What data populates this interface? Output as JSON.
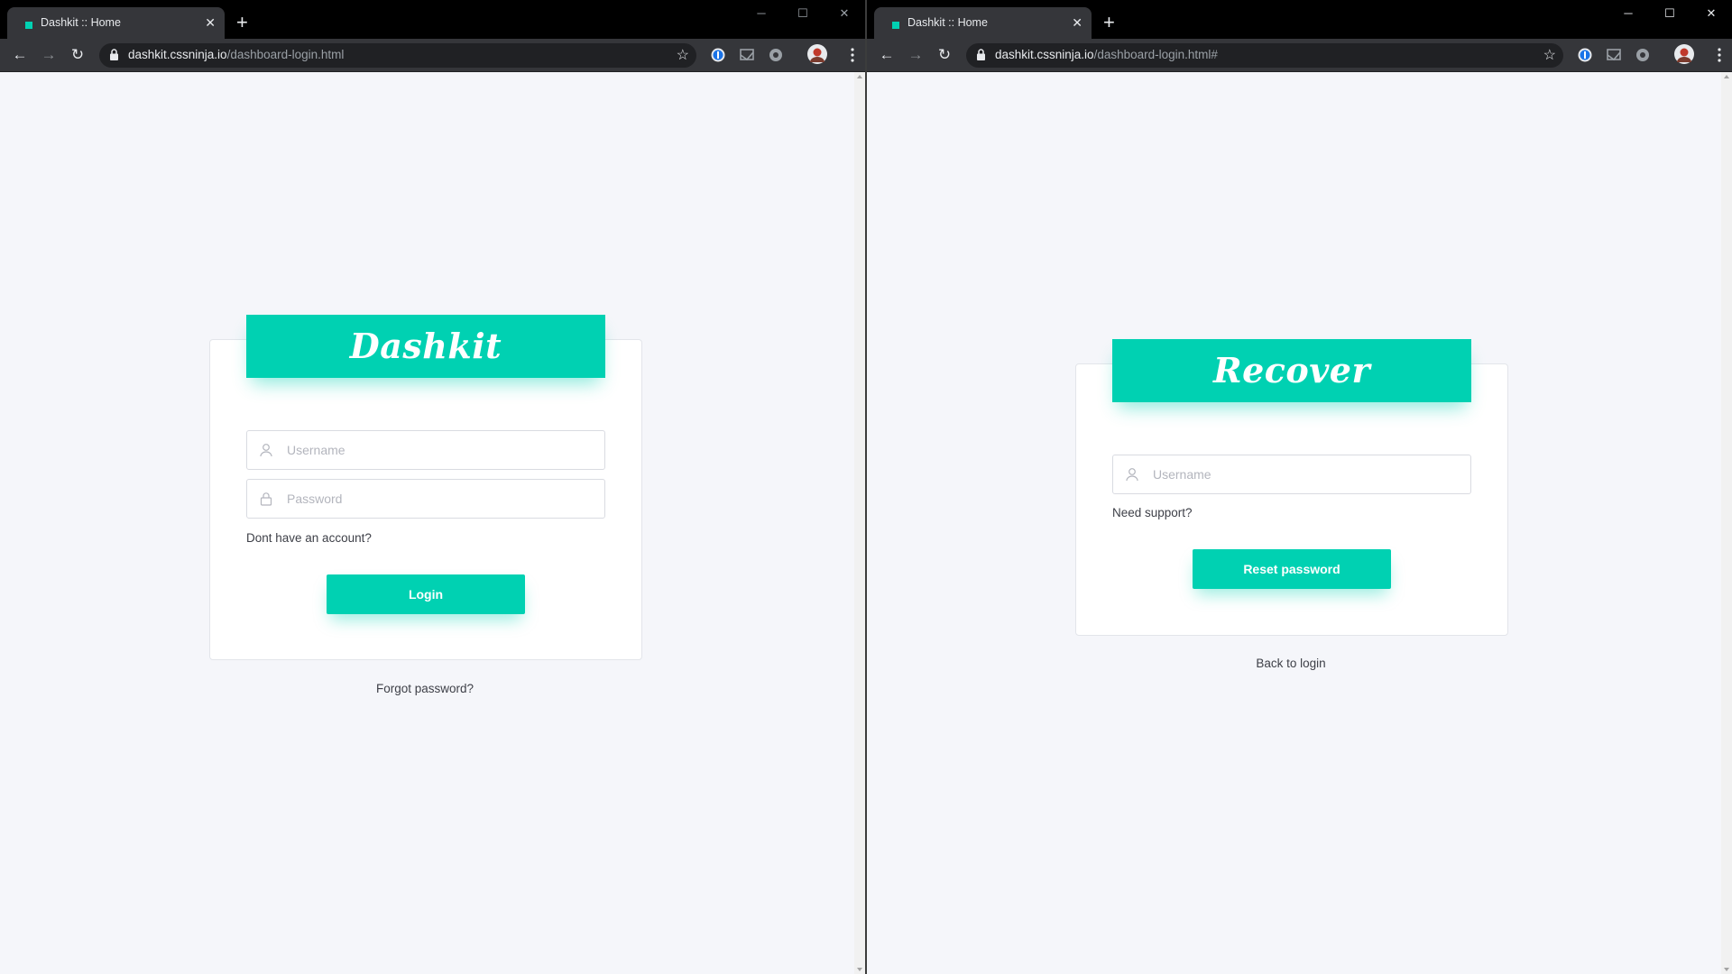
{
  "left_window": {
    "tab_title": "Dashkit :: Home",
    "url_host": "dashkit.cssninja.io",
    "url_path": "/dashboard-login.html",
    "page": {
      "brand": "Dashkit",
      "username_placeholder": "Username",
      "password_placeholder": "Password",
      "signup_link": "Dont have an account?",
      "login_button": "Login",
      "forgot_link": "Forgot password?"
    }
  },
  "right_window": {
    "tab_title": "Dashkit :: Home",
    "url_host": "dashkit.cssninja.io",
    "url_path": "/dashboard-login.html#",
    "page": {
      "heading": "Recover",
      "username_placeholder": "Username",
      "support_link": "Need support?",
      "reset_button": "Reset password",
      "back_link": "Back to login"
    }
  },
  "colors": {
    "accent": "#00d1b2",
    "page_background": "#f5f6fa",
    "browser_frame": "#35363a"
  },
  "icons": [
    "favicon",
    "close-icon",
    "new-tab-icon",
    "back-icon",
    "forward-icon",
    "reload-icon",
    "lock-icon",
    "star-icon",
    "password-manager-icon",
    "cast-icon",
    "extension-icon",
    "profile-avatar",
    "menu-icon",
    "user-icon",
    "padlock-icon"
  ]
}
